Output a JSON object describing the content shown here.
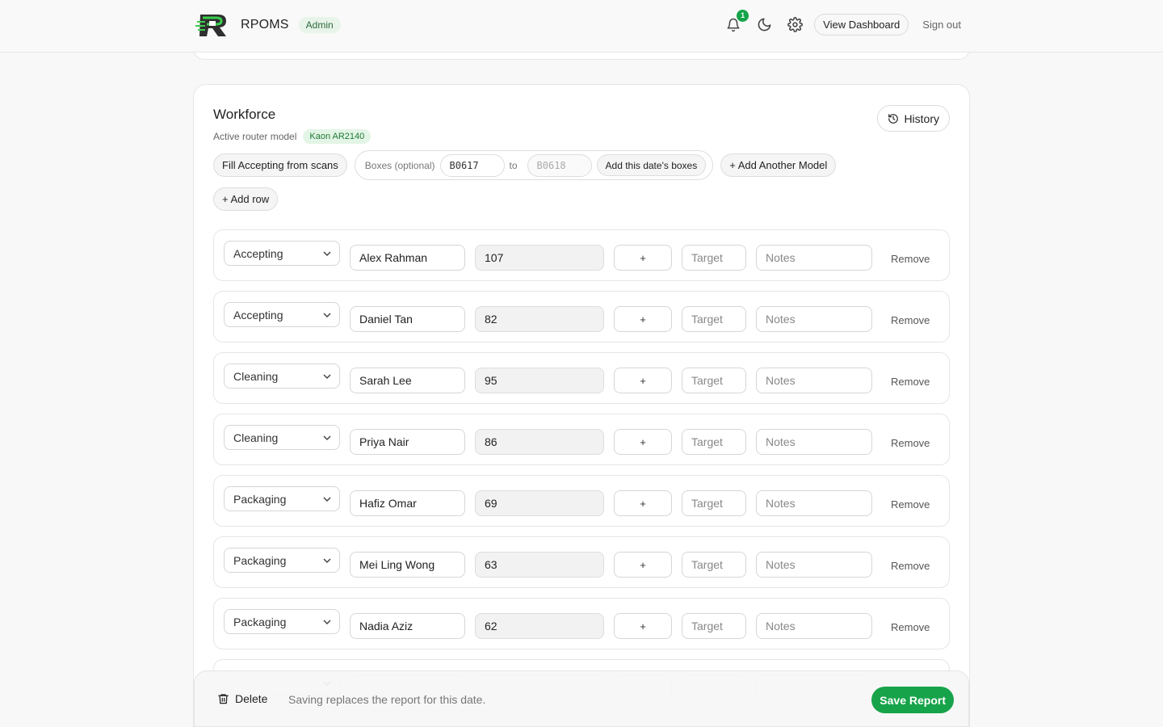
{
  "header": {
    "app_name": "RPOMS",
    "role": "Admin",
    "notifications_count": "1",
    "view_dashboard": "View Dashboard",
    "sign_out": "Sign out"
  },
  "workforce": {
    "title": "Workforce",
    "active_model_label": "Active router model",
    "active_model": "Kaon AR2140",
    "history_label": "History",
    "fill_accepting_label": "Fill Accepting from scans",
    "boxes_label": "Boxes (optional)",
    "box_from": "B0617",
    "to_label": "to",
    "box_to_placeholder": "B0618",
    "add_boxes_label": "Add this date's boxes",
    "add_model_label": "+ Add Another Model",
    "add_row_label": "+ Add row"
  },
  "rows": [
    {
      "stage": "Accepting",
      "name": "Alex Rahman",
      "qty": "107",
      "plus": "+",
      "target": "Target",
      "notes": "Notes",
      "remove": "Remove"
    },
    {
      "stage": "Accepting",
      "name": "Daniel Tan",
      "qty": "82",
      "plus": "+",
      "target": "Target",
      "notes": "Notes",
      "remove": "Remove"
    },
    {
      "stage": "Cleaning",
      "name": "Sarah Lee",
      "qty": "95",
      "plus": "+",
      "target": "Target",
      "notes": "Notes",
      "remove": "Remove"
    },
    {
      "stage": "Cleaning",
      "name": "Priya Nair",
      "qty": "86",
      "plus": "+",
      "target": "Target",
      "notes": "Notes",
      "remove": "Remove"
    },
    {
      "stage": "Packaging",
      "name": "Hafiz Omar",
      "qty": "69",
      "plus": "+",
      "target": "Target",
      "notes": "Notes",
      "remove": "Remove"
    },
    {
      "stage": "Packaging",
      "name": "Mei Ling Wong",
      "qty": "63",
      "plus": "+",
      "target": "Target",
      "notes": "Notes",
      "remove": "Remove"
    },
    {
      "stage": "Packaging",
      "name": "Nadia Aziz",
      "qty": "62",
      "plus": "+",
      "target": "Target",
      "notes": "Notes",
      "remove": "Remove"
    }
  ],
  "footer": {
    "delete_label": "Delete",
    "hint": "Saving replaces the report for this date.",
    "save_label": "Save Report"
  },
  "colors": {
    "accent": "#17a34a",
    "badge_green_bg": "#e3f5e6",
    "badge_green_text": "#1e7a34"
  },
  "icons": [
    "logo-icon",
    "bell-icon",
    "moon-icon",
    "gear-icon",
    "history-icon",
    "chevron-down-icon",
    "trash-icon"
  ]
}
